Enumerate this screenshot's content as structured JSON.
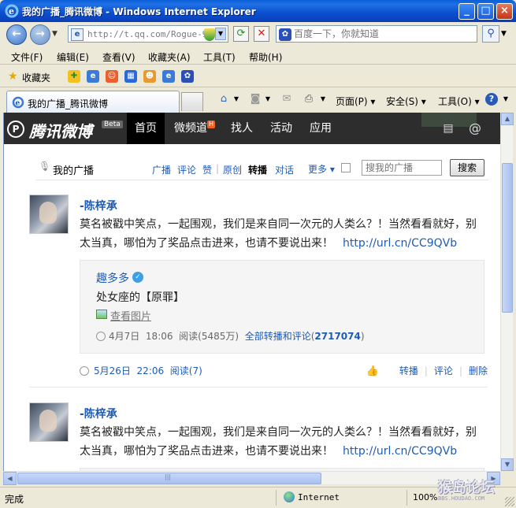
{
  "window": {
    "title": "我的广播_腾讯微博 - Windows Internet Explorer",
    "minimize": "_",
    "maximize": "□",
    "close": "×"
  },
  "address": {
    "url": "http://t.qq.com/Rogue-98",
    "search_placeholder": "百度一下，你就知道"
  },
  "menu": {
    "items": [
      "文件(F)",
      "编辑(E)",
      "查看(V)",
      "收藏夹(A)",
      "工具(T)",
      "帮助(H)"
    ]
  },
  "favorites": {
    "label": "收藏夹"
  },
  "tab": {
    "title": "我的广播_腾讯微博"
  },
  "commandbar": {
    "page": "页面(P)",
    "safety": "安全(S)",
    "tools": "工具(O)"
  },
  "weibo": {
    "logo_text": "腾讯微博",
    "beta": "Beta",
    "nav": [
      "首页",
      "微频道",
      "找人",
      "活动",
      "应用"
    ],
    "hot_badge": "H",
    "filter": {
      "title": "我的广播",
      "items": [
        "广播",
        "评论",
        "赞",
        "原创",
        "转播",
        "对话"
      ],
      "more": "更多",
      "search_placeholder": "搜我的广播",
      "search_button": "搜索"
    },
    "posts": [
      {
        "author": "-陈梓承",
        "text": "莫名被戳中笑点，一起围观，我们是来自同一次元的人类么？！当然看看就好，别太当真，哪怕为了奖品点击进来，也请不要说出来！",
        "link": "http://url.cn/CC9QVb",
        "repost": {
          "author": "趣多多",
          "text": "处女座的【原罪】",
          "view_image": "查看图片",
          "date": "4月7日",
          "time": "18:06",
          "reads": "阅读(5485万)",
          "all_link": "全部转播和评论",
          "count": "2717074"
        },
        "date": "5月26日",
        "time": "22:06",
        "reads": "阅读(7)",
        "actions": [
          "转播",
          "评论",
          "删除"
        ]
      },
      {
        "author": "-陈梓承",
        "text": "莫名被戳中笑点，一起围观，我们是来自同一次元的人类么？！当然看看就好，别太当真，哪怕为了奖品点击进来，也请不要说出来！",
        "link": "http://url.cn/CC9QVb"
      }
    ]
  },
  "status": {
    "text": "完成",
    "zone": "Internet",
    "zoom": "100%",
    "watermark": "猴岛论坛",
    "watermark_sub": "BBS.HOUDAO.COM"
  }
}
